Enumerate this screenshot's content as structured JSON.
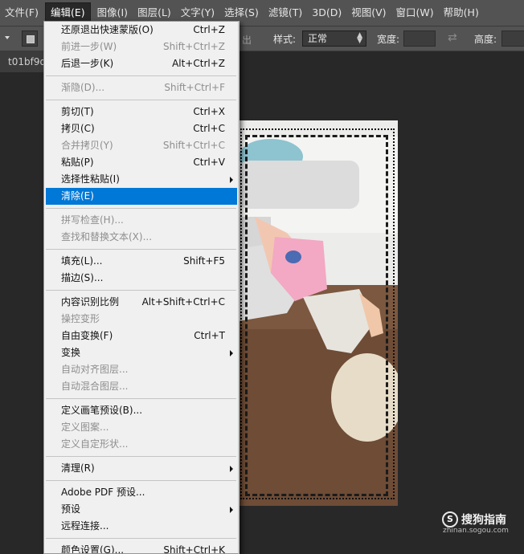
{
  "menubar": {
    "items": [
      "文件(F)",
      "编辑(E)",
      "图像(I)",
      "图层(L)",
      "文字(Y)",
      "选择(S)",
      "滤镜(T)",
      "3D(D)",
      "视图(V)",
      "窗口(W)",
      "帮助(H)"
    ]
  },
  "options": {
    "hint": "出",
    "style_label": "样式:",
    "style_value": "正常",
    "width_label": "宽度:",
    "height_label": "高度:"
  },
  "doc_tab": {
    "title": "t01bf9d"
  },
  "edit_menu": {
    "items": [
      {
        "label": "还原退出快速蒙版(O)",
        "shortcut": "Ctrl+Z",
        "disabled": false
      },
      {
        "label": "前进一步(W)",
        "shortcut": "Shift+Ctrl+Z",
        "disabled": true
      },
      {
        "label": "后退一步(K)",
        "shortcut": "Alt+Ctrl+Z",
        "disabled": false
      },
      {
        "label": "渐隐(D)...",
        "shortcut": "Shift+Ctrl+F",
        "disabled": true
      },
      {
        "label": "剪切(T)",
        "shortcut": "Ctrl+X",
        "disabled": false
      },
      {
        "label": "拷贝(C)",
        "shortcut": "Ctrl+C",
        "disabled": false
      },
      {
        "label": "合并拷贝(Y)",
        "shortcut": "Shift+Ctrl+C",
        "disabled": true
      },
      {
        "label": "粘贴(P)",
        "shortcut": "Ctrl+V",
        "disabled": false
      },
      {
        "label": "选择性粘贴(I)",
        "shortcut": "",
        "disabled": false,
        "submenu": true
      },
      {
        "label": "清除(E)",
        "shortcut": "",
        "disabled": false,
        "highlighted": true
      },
      {
        "label": "拼写检查(H)...",
        "shortcut": "",
        "disabled": true
      },
      {
        "label": "查找和替换文本(X)...",
        "shortcut": "",
        "disabled": true
      },
      {
        "label": "填充(L)...",
        "shortcut": "Shift+F5",
        "disabled": false
      },
      {
        "label": "描边(S)...",
        "shortcut": "",
        "disabled": false
      },
      {
        "label": "内容识别比例",
        "shortcut": "Alt+Shift+Ctrl+C",
        "disabled": false
      },
      {
        "label": "操控变形",
        "shortcut": "",
        "disabled": true
      },
      {
        "label": "自由变换(F)",
        "shortcut": "Ctrl+T",
        "disabled": false
      },
      {
        "label": "变换",
        "shortcut": "",
        "disabled": false,
        "submenu": true
      },
      {
        "label": "自动对齐图层...",
        "shortcut": "",
        "disabled": true
      },
      {
        "label": "自动混合图层...",
        "shortcut": "",
        "disabled": true
      },
      {
        "label": "定义画笔预设(B)...",
        "shortcut": "",
        "disabled": false
      },
      {
        "label": "定义图案...",
        "shortcut": "",
        "disabled": true
      },
      {
        "label": "定义自定形状...",
        "shortcut": "",
        "disabled": true
      },
      {
        "label": "清理(R)",
        "shortcut": "",
        "disabled": false,
        "submenu": true
      },
      {
        "label": "Adobe PDF 预设...",
        "shortcut": "",
        "disabled": false
      },
      {
        "label": "预设",
        "shortcut": "",
        "disabled": false,
        "submenu": true
      },
      {
        "label": "远程连接...",
        "shortcut": "",
        "disabled": false
      },
      {
        "label": "颜色设置(G)...",
        "shortcut": "Shift+Ctrl+K",
        "disabled": false
      }
    ]
  },
  "watermark": {
    "brand": "搜狗指南",
    "url": "zhinan.sogou.com"
  }
}
